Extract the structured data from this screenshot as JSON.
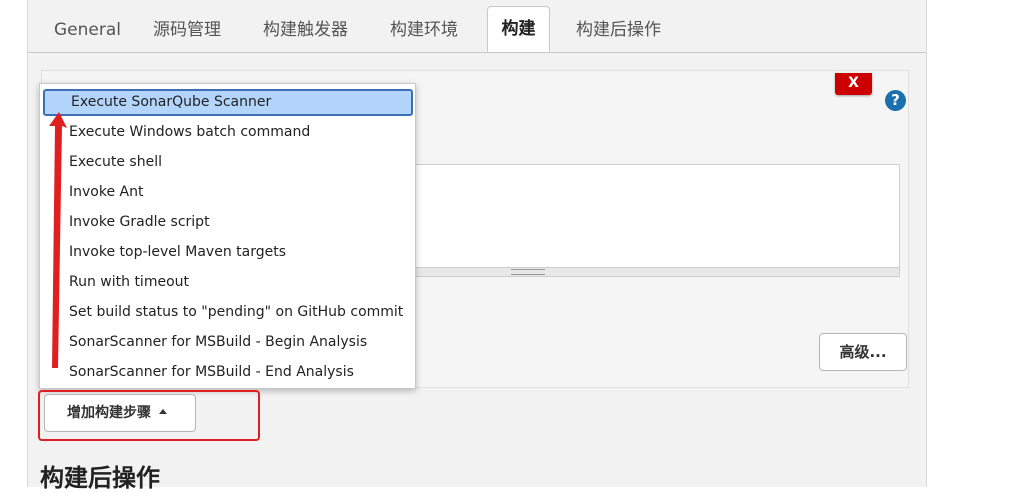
{
  "tabs": [
    {
      "label": "General"
    },
    {
      "label": "源码管理"
    },
    {
      "label": "构建触发器"
    },
    {
      "label": "构建环境"
    },
    {
      "label": "构建"
    },
    {
      "label": "构建后操作"
    }
  ],
  "active_tab": "构建",
  "build_step": {
    "delete_label": "X",
    "help_label": "?",
    "advanced_label": "高级..."
  },
  "dropdown": {
    "items": [
      {
        "label": "Execute SonarQube Scanner",
        "selected": true
      },
      {
        "label": "Execute Windows batch command"
      },
      {
        "label": "Execute shell"
      },
      {
        "label": "Invoke Ant"
      },
      {
        "label": "Invoke Gradle script"
      },
      {
        "label": "Invoke top-level Maven targets"
      },
      {
        "label": "Run with timeout"
      },
      {
        "label": "Set build status to \"pending\" on GitHub commit"
      },
      {
        "label": "SonarScanner for MSBuild - Begin Analysis"
      },
      {
        "label": "SonarScanner for MSBuild - End Analysis"
      }
    ]
  },
  "add_step_button": {
    "label": "增加构建步骤"
  },
  "section": {
    "post_build_heading": "构建后操作"
  },
  "colors": {
    "annotation": "#e02020",
    "selected_item_bg": "#b3d4fb",
    "delete_button": "#cc0000",
    "help_icon": "#1a6fae"
  },
  "icons": [
    "caret-up-icon",
    "help-icon",
    "close-icon"
  ]
}
